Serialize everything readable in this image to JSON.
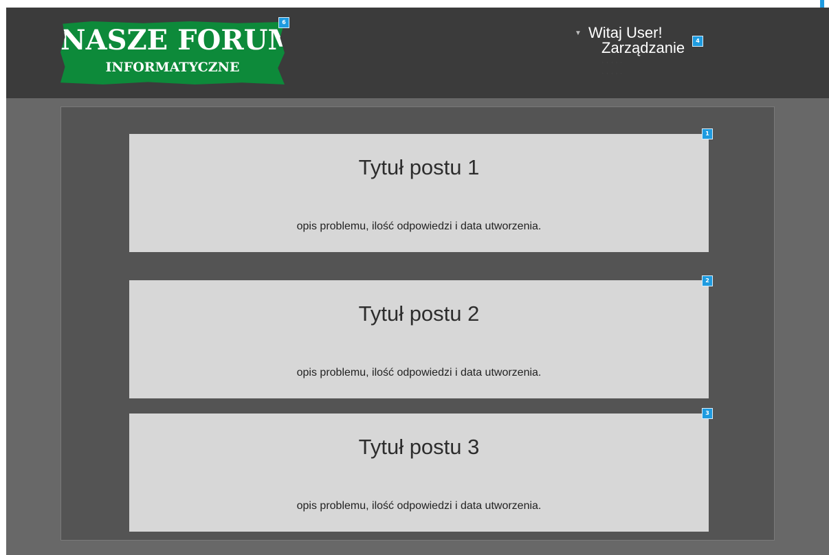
{
  "header": {
    "logo": {
      "main_text": "NASZE FORUM",
      "sub_text": "INFORMATYCZNE",
      "color": "#0d8a3a"
    },
    "user_menu": {
      "caret_icon": "caret-down-icon",
      "welcome": "Witaj User!",
      "items": [
        "Zarządzanie"
      ]
    }
  },
  "posts": [
    {
      "title": "Tytuł postu 1",
      "description": "opis problemu, ilość odpowiedzi i data utworzenia."
    },
    {
      "title": "Tytuł postu 2",
      "description": "opis problemu, ilość odpowiedzi i data utworzenia."
    },
    {
      "title": "Tytuł postu 3",
      "description": "opis problemu, ilość odpowiedzi i data utworzenia."
    }
  ],
  "markers": {
    "post1": "1",
    "post2": "2",
    "post3": "3",
    "user_menu": "4",
    "logo": "6"
  },
  "colors": {
    "header_bg": "#3b3b3b",
    "page_bg": "#686868",
    "content_bg": "#545454",
    "card_bg": "#d7d7d7",
    "marker": "#1e9be0"
  }
}
